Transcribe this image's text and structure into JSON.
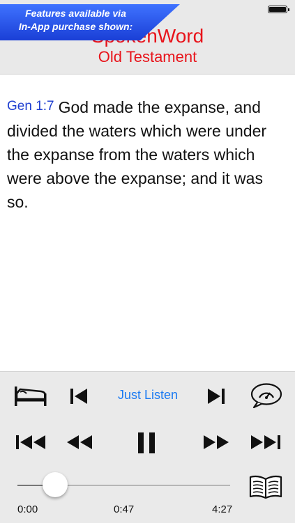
{
  "promo": {
    "banner_line1": "Features available via",
    "banner_line2": "In-App purchase shown:"
  },
  "header": {
    "title": "SpokenWord",
    "subtitle": "Old Testament"
  },
  "verse": {
    "reference": "Gen 1:7",
    "text": "God made the expanse, and divided the waters which were under the expanse from the waters which were above the expanse; and it was so."
  },
  "player": {
    "mode_label": "Just Listen",
    "progress": {
      "start_time": "0:00",
      "current_time": "0:47",
      "end_time": "4:27",
      "fraction": 0.176
    }
  },
  "icons": {
    "status": "battery-icon",
    "row1": [
      "sleep-timer-icon",
      "previous-verse-icon",
      "next-verse-icon",
      "playback-speed-icon"
    ],
    "row2": [
      "skip-to-start-icon",
      "rewind-icon",
      "pause-icon",
      "fast-forward-icon",
      "skip-to-end-icon"
    ],
    "bottom": "book-icon"
  },
  "colors": {
    "title_red": "#e8141b",
    "link_blue": "#1f3fd0",
    "accent_blue": "#1a7af2",
    "banner_blue": "#2a55e8"
  }
}
